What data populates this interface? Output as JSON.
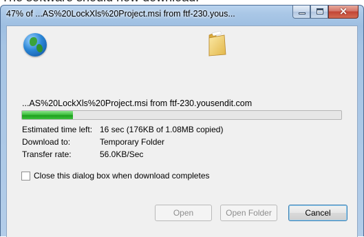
{
  "top_text": "The software should now download.",
  "window": {
    "title": "47% of ...AS%20LockXls%20Project.msi from ftf-230.yous...",
    "caption": {
      "minimize": "minimize-icon",
      "maximize": "maximize-icon",
      "close": "×"
    }
  },
  "icons": {
    "source": "globe-icon",
    "destination": "folder-icon"
  },
  "download": {
    "filename": "...AS%20LockXls%20Project.msi from ftf-230.yousendit.com",
    "progress": 0.16,
    "estimated_label": "Estimated time left:",
    "estimated_value": "16 sec (176KB of 1.08MB copied)",
    "download_to_label": "Download to:",
    "download_to_value": "Temporary Folder",
    "rate_label": "Transfer rate:",
    "rate_value": "56.0KB/Sec"
  },
  "close_on_complete": {
    "label": "Close this dialog box when download completes",
    "checked": false
  },
  "buttons": {
    "open": "Open",
    "open_folder": "Open Folder",
    "cancel": "Cancel"
  },
  "colors": {
    "progress": "#2db52d",
    "titlebar": "#a9c7e6",
    "close_button": "#c24535"
  }
}
